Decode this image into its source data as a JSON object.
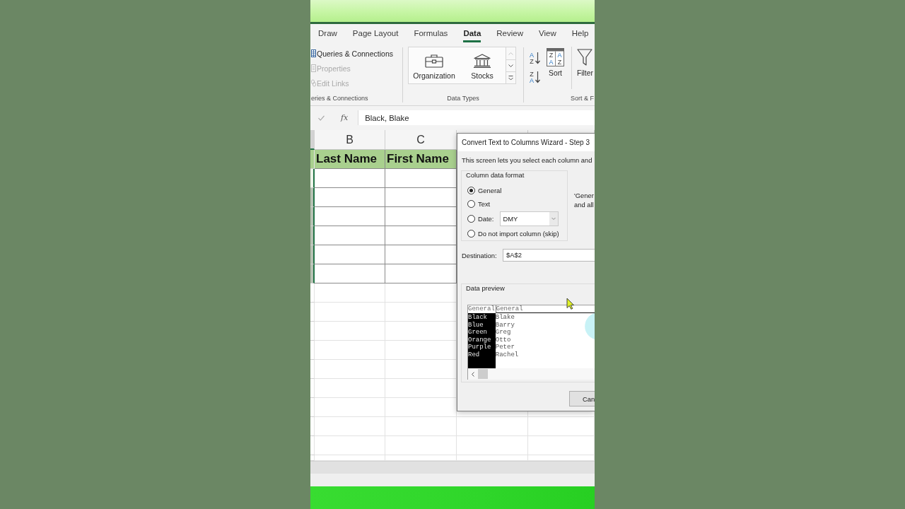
{
  "ribbon": {
    "tabs": [
      {
        "label": "Draw",
        "selected": false
      },
      {
        "label": "Page Layout",
        "selected": false
      },
      {
        "label": "Formulas",
        "selected": false
      },
      {
        "label": "Data",
        "selected": true
      },
      {
        "label": "Review",
        "selected": false
      },
      {
        "label": "View",
        "selected": false
      },
      {
        "label": "Help",
        "selected": false
      }
    ],
    "groups": [
      {
        "kind": "list",
        "label": "eries & Connections",
        "items": [
          {
            "kind": "queries",
            "label": "Queries & Connections",
            "disabled": false
          },
          {
            "kind": "properties",
            "label": "Properties",
            "disabled": true
          },
          {
            "kind": "links",
            "label": "Edit Links",
            "disabled": true
          }
        ]
      },
      {
        "kind": "gallery",
        "label": "Data Types",
        "items": [
          {
            "kind": "organization",
            "label": "Organization"
          },
          {
            "kind": "stocks",
            "label": "Stocks"
          }
        ],
        "scroll_buttons": [
          {
            "kind": "up",
            "disabled": true
          },
          {
            "kind": "down",
            "disabled": false
          },
          {
            "kind": "more",
            "disabled": false
          }
        ]
      },
      {
        "kind": "sort",
        "label": "Sort & F",
        "items": [
          {
            "kind": "sort_az",
            "glyphs": [
              "A",
              "Z"
            ]
          },
          {
            "kind": "sort_za",
            "glyphs": [
              "Z",
              "A"
            ]
          },
          {
            "kind": "sort",
            "label": "Sort",
            "glyphs": [
              "Z",
              "A",
              "A",
              "Z"
            ]
          },
          {
            "kind": "filter",
            "label": "Filter"
          }
        ]
      }
    ]
  },
  "formula_bar": {
    "function_label": "fx",
    "value": "Black, Blake"
  },
  "sheet": {
    "columns": [
      {
        "label": "B"
      },
      {
        "label": "C"
      }
    ],
    "header_row": [
      "Last Name",
      "First Name"
    ]
  },
  "dialog": {
    "title": "Convert Text to Columns Wizard - Step 3",
    "instruction": "This screen lets you select each column and",
    "format_group": {
      "label": "Column data format",
      "options": [
        {
          "label": "General",
          "selected": true
        },
        {
          "label": "Text",
          "selected": false
        },
        {
          "label": "Date:",
          "selected": false,
          "dropdown": "DMY"
        },
        {
          "label": "Do not import column (skip)",
          "selected": false
        }
      ]
    },
    "description": [
      "'Gener",
      "and all"
    ],
    "destination": {
      "label": "Destination:",
      "value": "$A$2"
    },
    "preview": {
      "label": "Data preview",
      "columns": [
        {
          "header": "General",
          "selected": true,
          "cells": [
            "Black",
            "Blue",
            "Green",
            "Orange",
            "Purple",
            "Red"
          ]
        },
        {
          "header": "General",
          "selected": false,
          "cells": [
            "Blake",
            "Barry",
            "Greg",
            "Otto",
            "Peter",
            "Rachel"
          ]
        }
      ]
    },
    "buttons": [
      "Can"
    ]
  }
}
